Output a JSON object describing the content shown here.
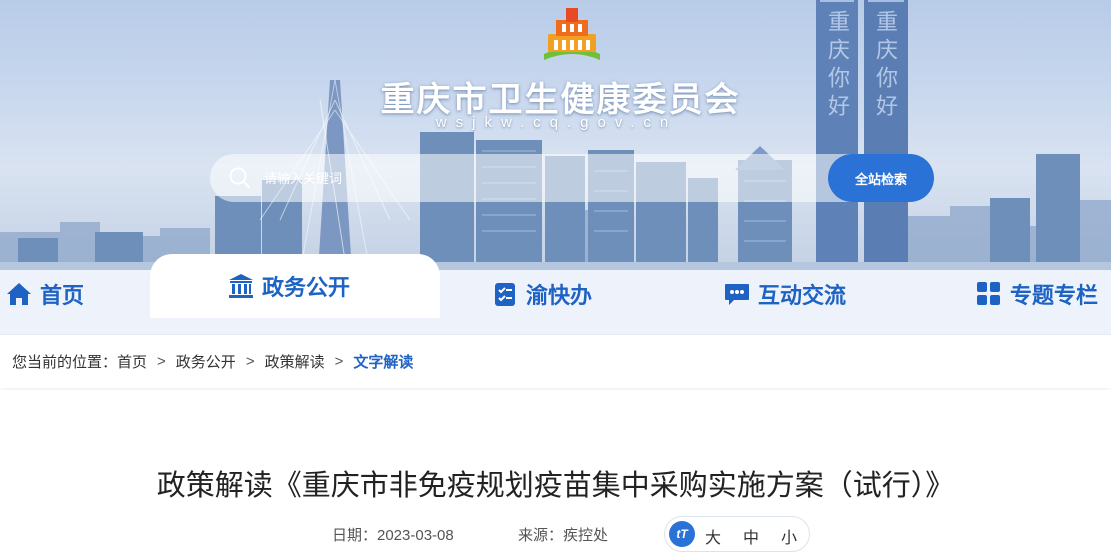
{
  "header": {
    "site_title": "重庆市卫生健康委员会",
    "site_domain": "wsjkw.cq.gov.cn",
    "tower_text_left": "重庆你好",
    "tower_text_right": "重庆你好"
  },
  "search": {
    "placeholder": "请输入关键词",
    "button_label": "全站检索"
  },
  "nav": {
    "items": [
      {
        "label": "首页",
        "icon": "home-icon",
        "active": false
      },
      {
        "label": "政务公开",
        "icon": "government-building-icon",
        "active": true
      },
      {
        "label": "渝快办",
        "icon": "clipboard-checklist-icon",
        "active": false
      },
      {
        "label": "互动交流",
        "icon": "chat-bubble-icon",
        "active": false
      },
      {
        "label": "专题专栏",
        "icon": "grid-icon",
        "active": false
      }
    ]
  },
  "breadcrumb": {
    "prefix": "您当前的位置：",
    "items": [
      "首页",
      "政务公开",
      "政策解读",
      "文字解读"
    ],
    "separator": ">"
  },
  "article": {
    "title": "政策解读《重庆市非免疫规划疫苗集中采购实施方案（试行）》",
    "date": "日期：2023-03-08",
    "source": "来源：疾控处"
  },
  "font_size": {
    "icon_label": "tT",
    "large": "大",
    "medium": "中",
    "small": "小"
  },
  "colors": {
    "accent": "#1e63c4",
    "button": "#2a72d6"
  }
}
